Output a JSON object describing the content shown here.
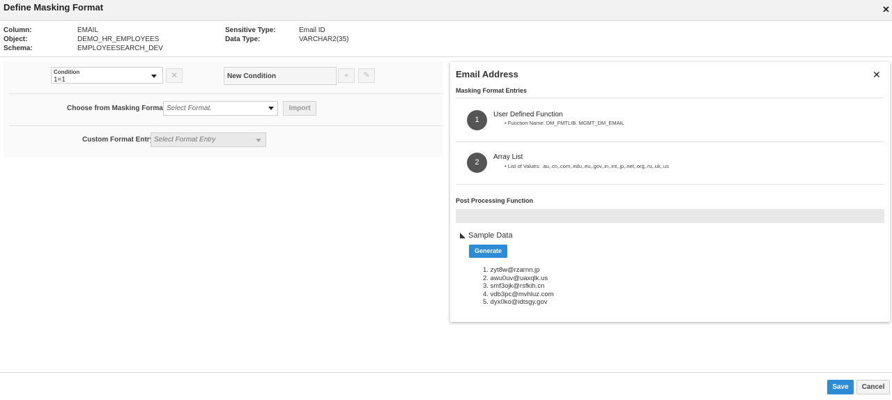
{
  "dialog": {
    "title": "Define Masking Format",
    "close_icon": "close-icon"
  },
  "info": {
    "column_label": "Column:",
    "column_value": "EMAIL",
    "object_label": "Object:",
    "object_value": "DEMO_HR_EMPLOYEES",
    "schema_label": "Schema:",
    "schema_value": "EMPLOYEESEARCH_DEV",
    "sensitive_type_label": "Sensitive Type:",
    "sensitive_type_value": "Email ID",
    "data_type_label": "Data Type:",
    "data_type_value": "VARCHAR2(35)"
  },
  "condition": {
    "label": "Condition",
    "value": "1=1",
    "new_condition": "New Condition"
  },
  "masking_formats": {
    "label": "Choose from Masking Formats",
    "placeholder": "Select Format.",
    "import_label": "Import"
  },
  "custom_entry": {
    "label": "Custom Format Entry",
    "placeholder": "Select Format Entry"
  },
  "detail_panel": {
    "title": "Email Address",
    "entries_heading": "Masking Format Entries",
    "entries": [
      {
        "number": "1",
        "title": "User Defined Function",
        "detail": "Function Name: DM_FMTLIB. MGMT_DM_EMAIL"
      },
      {
        "number": "2",
        "title": "Array List",
        "detail": "List of Values: .au,.cn,.com,.edu,.eu,.gov,.in,.int,.jp,.net,.org,.ru,.uk,.us"
      }
    ],
    "post_processing_heading": "Post Processing Function",
    "sample_data_label": "Sample Data",
    "generate_label": "Generate",
    "samples": [
      "1. zyt8w@rzarnn.jp",
      "2. awu0uv@uaxqlk.us",
      "3. smf3ojk@rsfkih.cn",
      "4. vdb3pc@mvhluz.com",
      "5. dyx0ko@idtsgy.gov"
    ]
  },
  "footer": {
    "save_label": "Save",
    "cancel_label": "Cancel"
  }
}
